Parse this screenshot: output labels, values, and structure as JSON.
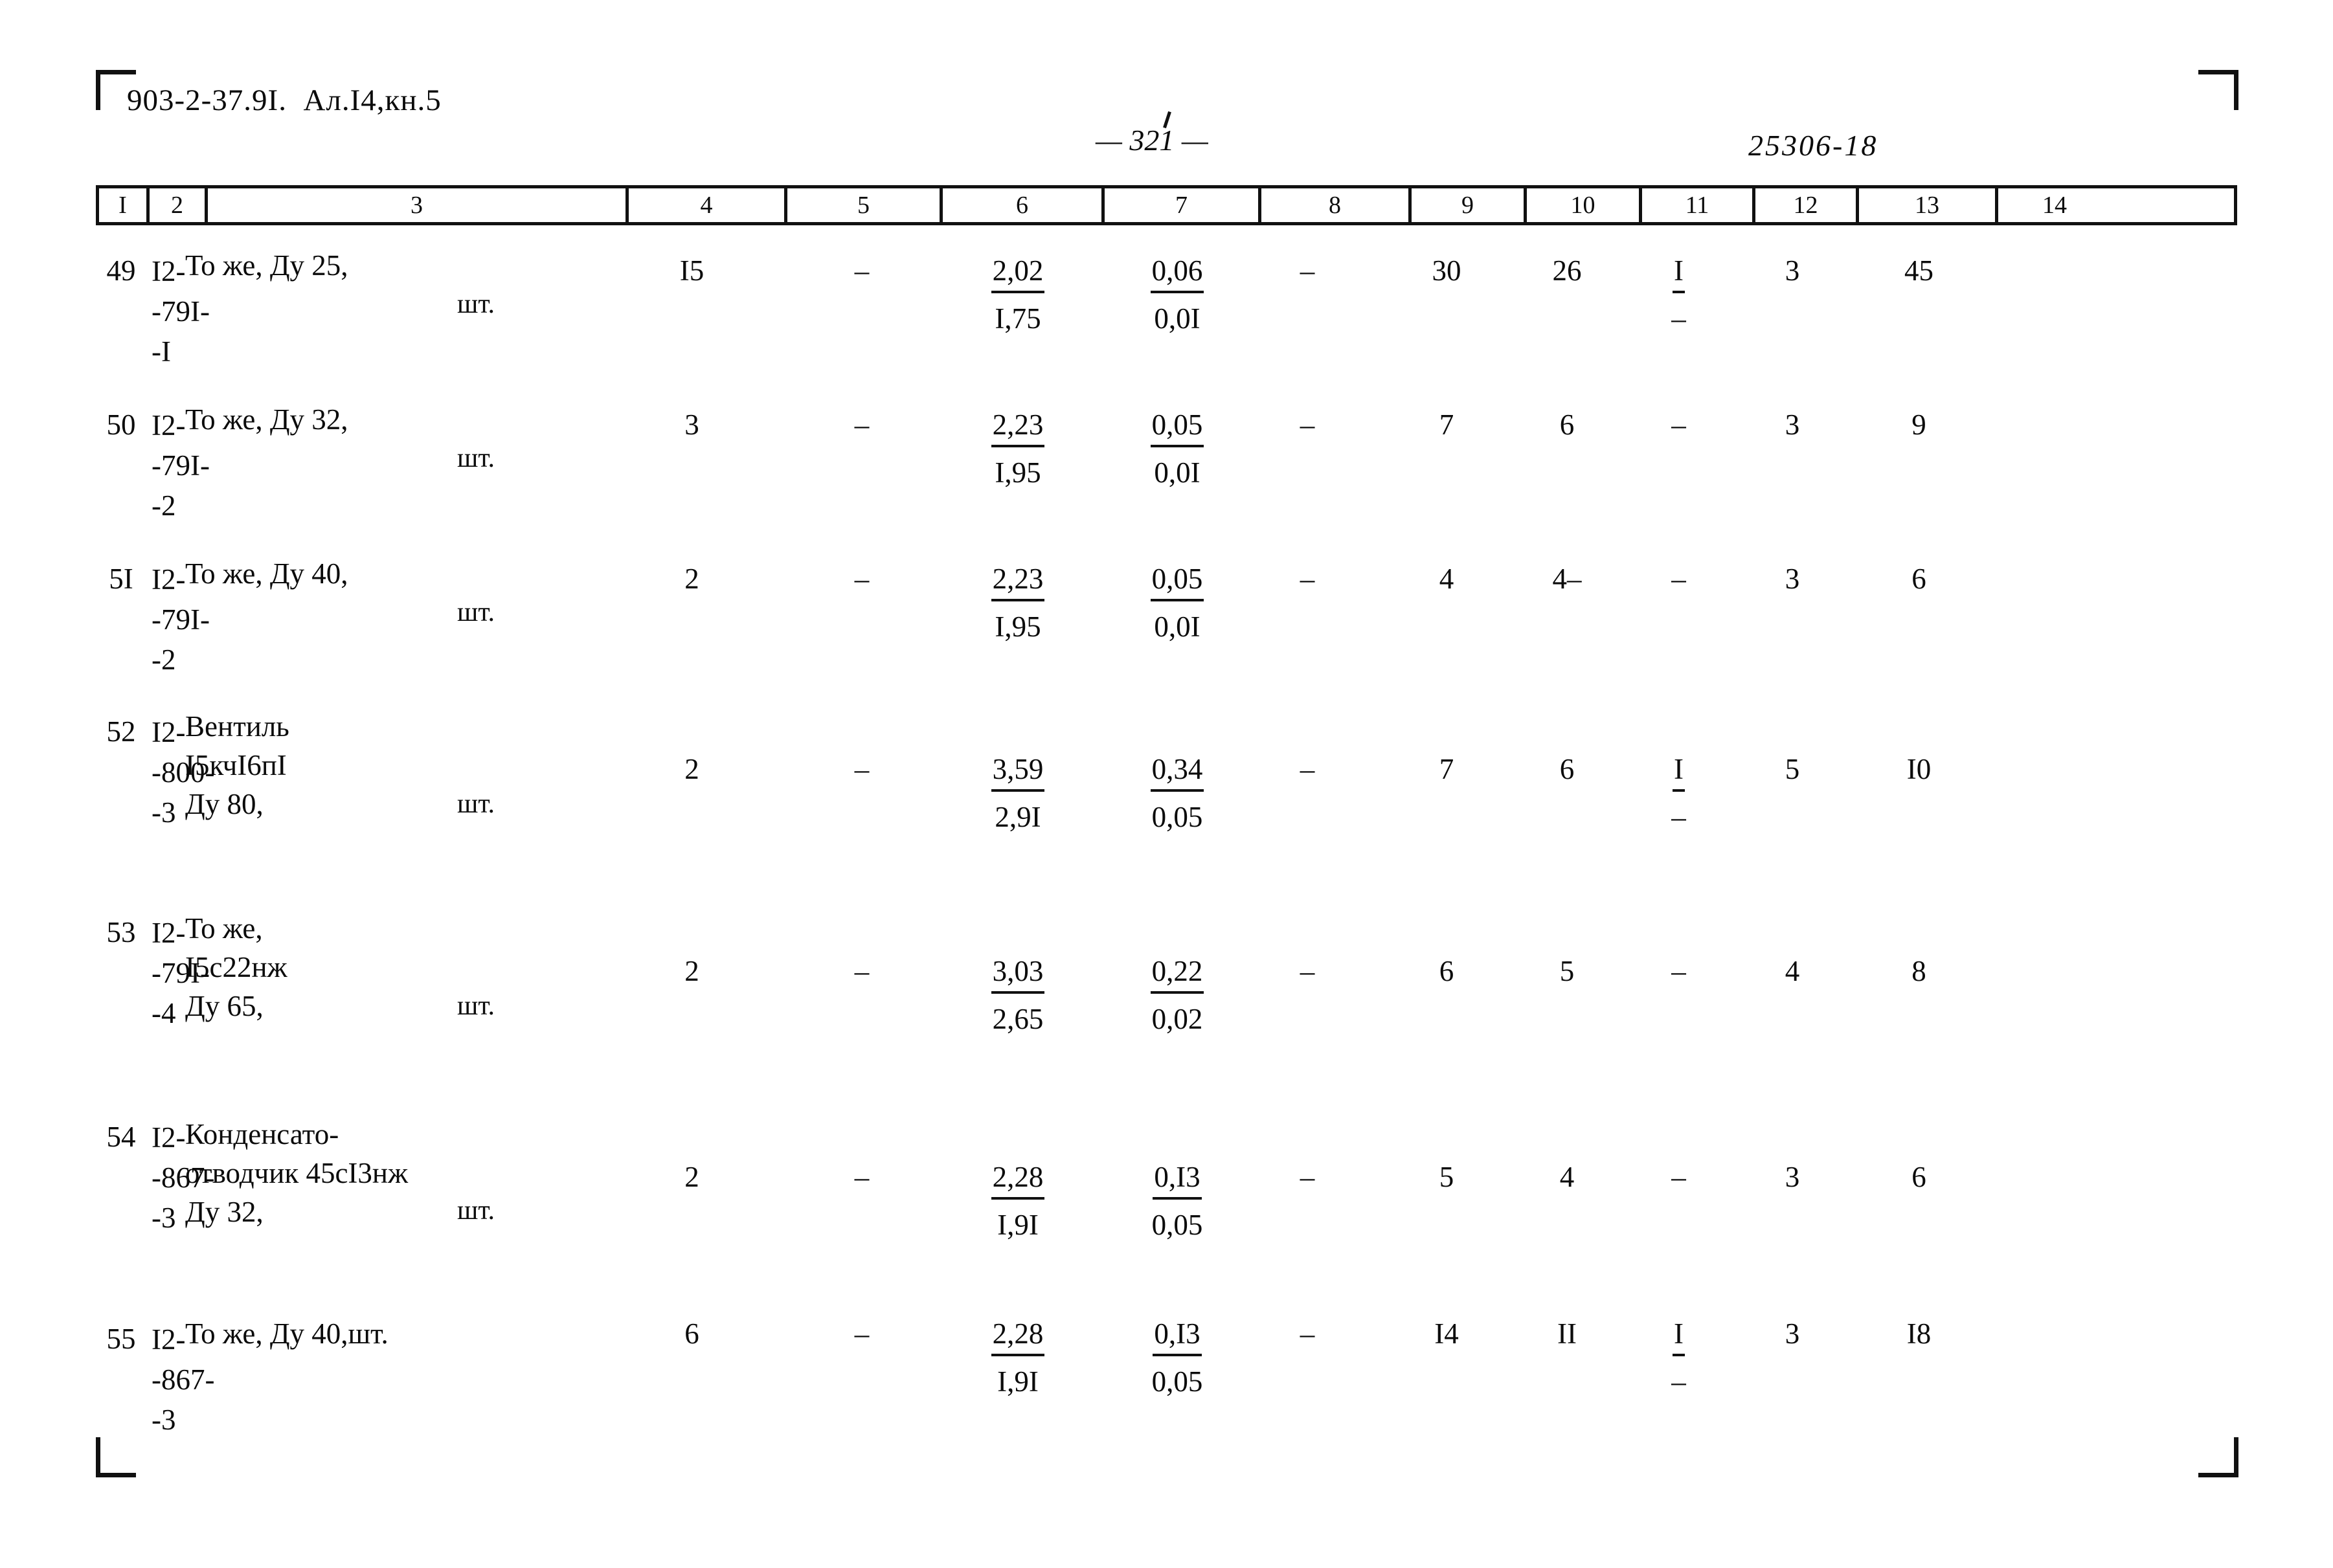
{
  "document": {
    "header_code": "903-2-37.9I.  Ал.I4,кн.5",
    "page_number": "— 321 —",
    "archive_stamp": "25306-18"
  },
  "table": {
    "column_headers": [
      "I",
      "2",
      "3",
      "4",
      "5",
      "6",
      "7",
      "8",
      "9",
      "10",
      "11",
      "12",
      "13",
      "14"
    ],
    "rows": [
      {
        "num": "49",
        "code_lines": [
          "I2-",
          "-79I-",
          "-I"
        ],
        "name_lines": [
          "То же, Ду 25,"
        ],
        "unit": "шт.",
        "c4": "I5",
        "c5": "–",
        "c6_num": "2,02",
        "c6_den": "I,75",
        "c7_num": "0,06",
        "c7_den": "0,0I",
        "c8": "–",
        "c9": "30",
        "c10": "26",
        "c11_num": "I",
        "c11_den": "–",
        "c12": "3",
        "c13": "45",
        "c14": ""
      },
      {
        "num": "50",
        "code_lines": [
          "I2-",
          "-79I-",
          "-2"
        ],
        "name_lines": [
          "То же, Ду 32,"
        ],
        "unit": "шт.",
        "c4": "3",
        "c5": "–",
        "c6_num": "2,23",
        "c6_den": "I,95",
        "c7_num": "0,05",
        "c7_den": "0,0I",
        "c8": "–",
        "c9": "7",
        "c10": "6",
        "c11_num": "–",
        "c11_den": "",
        "c12": "3",
        "c13": "9",
        "c14": ""
      },
      {
        "num": "5I",
        "code_lines": [
          "I2-",
          "-79I-",
          "-2"
        ],
        "name_lines": [
          "То же, Ду 40,"
        ],
        "unit": "шт.",
        "c4": "2",
        "c5": "–",
        "c6_num": "2,23",
        "c6_den": "I,95",
        "c7_num": "0,05",
        "c7_den": "0,0I",
        "c8": "–",
        "c9": "4",
        "c10": "4–",
        "c11_num": "–",
        "c11_den": "",
        "c12": "3",
        "c13": "6",
        "c14": ""
      },
      {
        "num": "52",
        "code_lines": [
          "I2-",
          "-800-",
          "-3"
        ],
        "name_lines": [
          "Вентиль",
          "I5кчI6пI",
          "Ду 80,"
        ],
        "unit": "шт.",
        "c4": "2",
        "c5": "–",
        "c6_num": "3,59",
        "c6_den": "2,9I",
        "c7_num": "0,34",
        "c7_den": "0,05",
        "c8": "–",
        "c9": "7",
        "c10": "6",
        "c11_num": "I",
        "c11_den": "–",
        "c12": "5",
        "c13": "I0",
        "c14": ""
      },
      {
        "num": "53",
        "code_lines": [
          "I2-",
          "-79I-",
          "-4"
        ],
        "name_lines": [
          "То же,",
          "I5с22нж",
          "Ду 65,"
        ],
        "unit": "шт.",
        "c4": "2",
        "c5": "–",
        "c6_num": "3,03",
        "c6_den": "2,65",
        "c7_num": "0,22",
        "c7_den": "0,02",
        "c8": "–",
        "c9": "6",
        "c10": "5",
        "c11_num": "–",
        "c11_den": "",
        "c12": "4",
        "c13": "8",
        "c14": ""
      },
      {
        "num": "54",
        "code_lines": [
          "I2-",
          "-867-",
          "-3"
        ],
        "name_lines": [
          "Конденсато-",
          "отводчик 45сI3нж",
          "Ду 32,"
        ],
        "unit": "шт.",
        "c4": "2",
        "c5": "–",
        "c6_num": "2,28",
        "c6_den": "I,9I",
        "c7_num": "0,I3",
        "c7_den": "0,05",
        "c8": "–",
        "c9": "5",
        "c10": "4",
        "c11_num": "–",
        "c11_den": "",
        "c12": "3",
        "c13": "6",
        "c14": ""
      },
      {
        "num": "55",
        "code_lines": [
          "I2-",
          "-867-",
          "-3"
        ],
        "name_lines": [
          "То же, Ду 40,шт."
        ],
        "unit": "",
        "c4": "6",
        "c5": "–",
        "c6_num": "2,28",
        "c6_den": "I,9I",
        "c7_num": "0,I3",
        "c7_den": "0,05",
        "c8": "–",
        "c9": "I4",
        "c10": "II",
        "c11_num": "I",
        "c11_den": "–",
        "c12": "3",
        "c13": "I8",
        "c14": ""
      }
    ]
  }
}
